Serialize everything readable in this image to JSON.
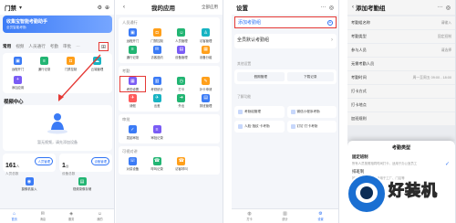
{
  "panel1": {
    "title": "门禁",
    "banner_line1": "收集宝智能考勤助手",
    "banner_line2": "全员智能考勤",
    "tabs": [
      "常用",
      "视频",
      "人员通行",
      "考勤",
      "审批",
      "···"
    ],
    "apps": [
      {
        "label": "远程开门",
        "color": "#3b7bf6"
      },
      {
        "label": "通行记录",
        "color": "#22b573"
      },
      {
        "label": "门禁控制",
        "color": "#ff9f1a"
      },
      {
        "label": "云端管理",
        "color": "#17b3c2"
      },
      {
        "label": "添加应用",
        "color": "#7a5cf5"
      }
    ],
    "video_title": "视频中心",
    "video_empty": "暂无视频，请先添加设备",
    "stats": [
      {
        "num": "161",
        "unit": "人",
        "caption": "人员总数",
        "pill": "人员管理"
      },
      {
        "num": "1",
        "unit": "台",
        "caption": "设备总数",
        "pill": "设备管理"
      }
    ],
    "bottom": [
      "摄像机接入",
      "视频录像存储"
    ],
    "nav": [
      "首页",
      "消息",
      "服务",
      "我的"
    ]
  },
  "panel2": {
    "title": "我的应用",
    "link": "全部应用",
    "groups": [
      {
        "name": "人员通行",
        "apps": [
          "远程开门",
          "门禁控制",
          "人员管理",
          "访客管理",
          "通行记录",
          "访客邀约",
          "设备管理",
          "设备分组"
        ]
      },
      {
        "name": "考勤",
        "apps": [
          "考勤设置",
          "考勤统计",
          "打卡",
          "补卡申请",
          "请假",
          "出差",
          "外出",
          "排班管理"
        ]
      },
      {
        "name": "审批",
        "apps": [
          "发起审批",
          "审批记录"
        ]
      },
      {
        "name": "可视对讲",
        "apps": [
          "对讲设备",
          "呼叫记录",
          "访客呼叫"
        ]
      }
    ]
  },
  "panel3": {
    "title": "设置",
    "add_label": "添加考勤组",
    "list_item": "全员默认考勤组",
    "other_settings": "其他设置",
    "other_btns": [
      "假期管理",
      "下载记录"
    ],
    "tools_title": "了解功能",
    "tools": [
      "考勤组管理",
      "微信小程序考勤",
      "人脸·指纹·卡考勤",
      "钉钉·打卡考勤"
    ],
    "nav": [
      "打卡",
      "统计",
      "设置"
    ]
  },
  "panel4": {
    "title": "添加考勤组",
    "rows": [
      {
        "label": "考勤组名称",
        "value": "请输入"
      },
      {
        "label": "考勤类型",
        "value": "固定班制"
      },
      {
        "label": "参与人员",
        "value": "请选择"
      },
      {
        "label": "无需考勤人员",
        "value": ""
      },
      {
        "label": "考勤时间",
        "value": "周一至周五 09:00 - 18:00"
      },
      {
        "label": "打卡方式",
        "value": ""
      },
      {
        "label": "打卡地点",
        "value": ""
      },
      {
        "label": "加班规则",
        "value": ""
      }
    ],
    "sheet_title": "考勤类型",
    "options": [
      {
        "name": "固定班制",
        "desc": "所有人员按照相同时间打卡，适用于办公室员工"
      },
      {
        "name": "排班制",
        "desc": "按排班进行考勤，适用于工厂、门店等"
      }
    ],
    "watermark": "好装机"
  },
  "colors": {
    "accent": "#2f73f5",
    "highlight": "#e53935"
  }
}
